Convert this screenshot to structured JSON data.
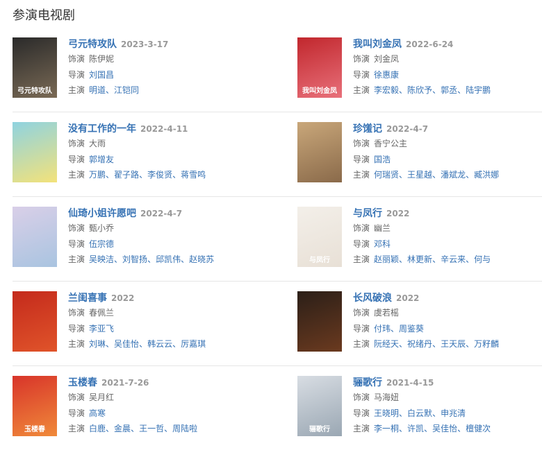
{
  "section_title": "参演电视剧",
  "labels": {
    "role": "饰演",
    "director": "导演",
    "cast": "主演"
  },
  "colors": {
    "link": "#3672b4",
    "muted": "#999999",
    "text": "#666666"
  },
  "shows": [
    {
      "title": "弓元特攻队",
      "date": "2023-3-17",
      "role": "陈伊妮",
      "director": [
        "刘国昌"
      ],
      "cast": [
        "明道",
        "江铠同"
      ],
      "poster_colors": [
        "#2a2a2a",
        "#7a6a55"
      ],
      "poster_text": "弓元特攻队"
    },
    {
      "title": "我叫刘金凤",
      "date": "2022-6-24",
      "role": "刘金凤",
      "director": [
        "徐惠康"
      ],
      "cast": [
        "李宏毅",
        "陈欣予",
        "郭丞",
        "陆宇鹏"
      ],
      "poster_colors": [
        "#c1272d",
        "#e8707a"
      ],
      "poster_text": "我叫刘金凤"
    },
    {
      "title": "没有工作的一年",
      "date": "2022-4-11",
      "role": "大雨",
      "director": [
        "郭增友"
      ],
      "cast": [
        "万鹏",
        "翟子路",
        "李俊贤",
        "蒋雪鸣"
      ],
      "poster_colors": [
        "#8fd3e0",
        "#f3e27a"
      ],
      "poster_text": ""
    },
    {
      "title": "珍馐记",
      "date": "2022-4-7",
      "role": "香宁公主",
      "director": [
        "国浩"
      ],
      "cast": [
        "何瑞贤",
        "王星越",
        "潘斌龙",
        "臧洪娜"
      ],
      "poster_colors": [
        "#c9a77a",
        "#8a6a4a"
      ],
      "poster_text": ""
    },
    {
      "title": "仙琦小姐许愿吧",
      "date": "2022-4-7",
      "role": "甄小乔",
      "director": [
        "伍宗德"
      ],
      "cast": [
        "吴映洁",
        "刘智扬",
        "邱凯伟",
        "赵晓苏"
      ],
      "poster_colors": [
        "#d9cfe8",
        "#a9c4e0"
      ],
      "poster_text": ""
    },
    {
      "title": "与凤行",
      "date": "2022",
      "role": "幽兰",
      "director": [
        "邓科"
      ],
      "cast": [
        "赵丽颖",
        "林更新",
        "辛云来",
        "何与"
      ],
      "poster_colors": [
        "#f3efe9",
        "#e8e0d6"
      ],
      "poster_text": "与凤行"
    },
    {
      "title": "兰闺喜事",
      "date": "2022",
      "role": "春佩兰",
      "director": [
        "李亚飞"
      ],
      "cast": [
        "刘琳",
        "吴佳怡",
        "韩云云",
        "厉嘉琪"
      ],
      "poster_colors": [
        "#c42a1c",
        "#e0542a"
      ],
      "poster_text": ""
    },
    {
      "title": "长风破浪",
      "date": "2022",
      "role": "虞若榣",
      "director": [
        "付玮",
        "周鉴葵"
      ],
      "cast": [
        "阮经天",
        "祝绪丹",
        "王天辰",
        "万籽麟"
      ],
      "poster_colors": [
        "#2b1f18",
        "#6b3a1f"
      ],
      "poster_text": ""
    },
    {
      "title": "玉楼春",
      "date": "2021-7-26",
      "role": "吴月红",
      "director": [
        "高寒"
      ],
      "cast": [
        "白鹿",
        "金晨",
        "王一哲",
        "周陆啦"
      ],
      "poster_colors": [
        "#d8342a",
        "#f08a3a"
      ],
      "poster_text": "玉楼春"
    },
    {
      "title": "骊歌行",
      "date": "2021-4-15",
      "role": "马海妞",
      "director": [
        "王晓明",
        "白云默",
        "申兆清"
      ],
      "cast": [
        "李一桐",
        "许凯",
        "吴佳怡",
        "檀健次"
      ],
      "poster_colors": [
        "#d8dde3",
        "#9aa7b3"
      ],
      "poster_text": "骊歌行"
    }
  ]
}
